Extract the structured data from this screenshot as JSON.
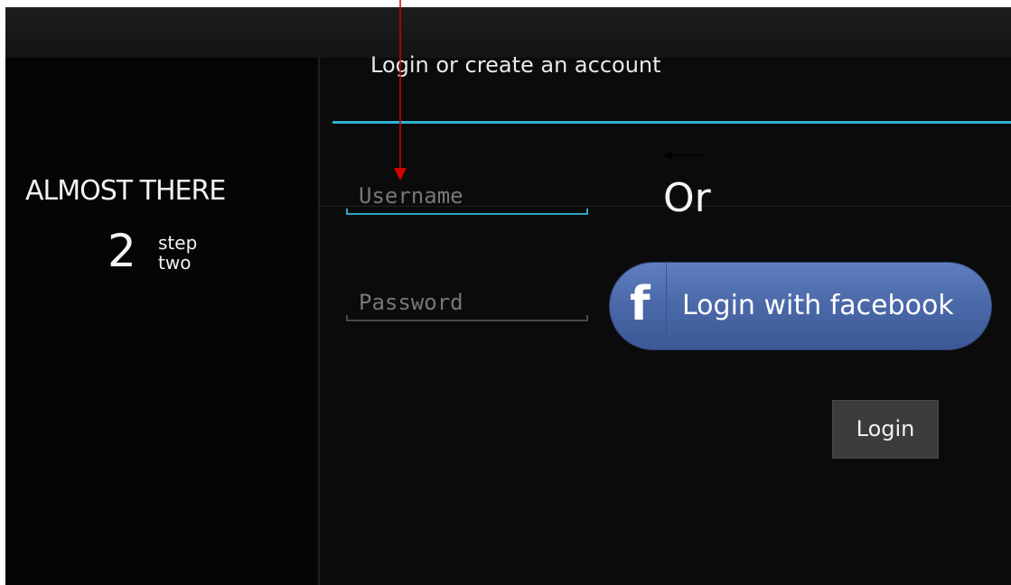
{
  "sidebar": {
    "title": "ALMOST THERE",
    "step_number": "2",
    "step_word1": "step",
    "step_word2": "two"
  },
  "header": {
    "title": "Login or create an account"
  },
  "form": {
    "username_placeholder": "Username",
    "password_placeholder": "Password",
    "login_label": "Login"
  },
  "divider_text": "Or",
  "facebook": {
    "logo_letter": "f",
    "label": "Login with facebook",
    "color": "#4a68a8"
  },
  "colors": {
    "background": "#0b0b0b",
    "accent": "#2fb1d1",
    "annotation_arrow": "#d00000"
  },
  "icons": [
    "facebook-logo-icon",
    "red-annotation-arrow-icon",
    "black-annotation-arrow-icon"
  ]
}
